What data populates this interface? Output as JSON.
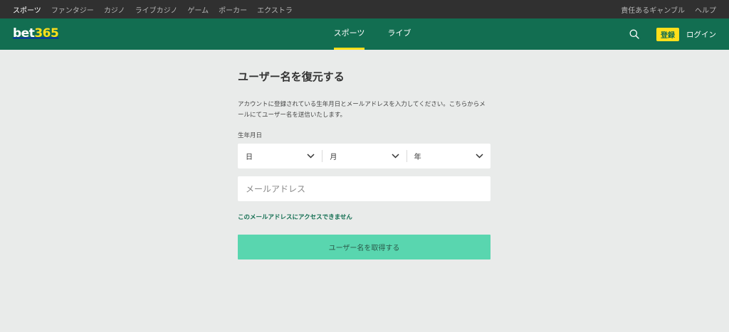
{
  "topbar": {
    "left_items": [
      {
        "label": "スポーツ",
        "active": true
      },
      {
        "label": "ファンタジー",
        "active": false
      },
      {
        "label": "カジノ",
        "active": false
      },
      {
        "label": "ライブカジノ",
        "active": false
      },
      {
        "label": "ゲーム",
        "active": false
      },
      {
        "label": "ポーカー",
        "active": false
      },
      {
        "label": "エクストラ",
        "active": false
      }
    ],
    "right_items": [
      {
        "label": "責任あるギャンブル"
      },
      {
        "label": "ヘルプ"
      }
    ]
  },
  "header": {
    "logo_part1": "bet",
    "logo_part2": "365",
    "nav": [
      {
        "label": "スポーツ",
        "active": true
      },
      {
        "label": "ライブ",
        "active": false
      }
    ],
    "search_icon": "search-icon",
    "register_label": "登録",
    "login_label": "ログイン"
  },
  "form": {
    "title": "ユーザー名を復元する",
    "description": "アカウントに登録されている生年月日とメールアドレスを入力してください。こちらからメールにてユーザー名を送信いたします。",
    "dob_label": "生年月日",
    "day_placeholder": "日",
    "month_placeholder": "月",
    "year_placeholder": "年",
    "email_value": "",
    "email_placeholder": "メールアドレス",
    "help_link": "このメールアドレスにアクセスできません",
    "submit_label": "ユーザー名を取得する"
  },
  "colors": {
    "topbar_bg": "#303030",
    "header_bg": "#126e51",
    "accent_yellow": "#ffdf1b",
    "submit_bg": "#59d6af",
    "page_bg": "#e9ebea"
  }
}
